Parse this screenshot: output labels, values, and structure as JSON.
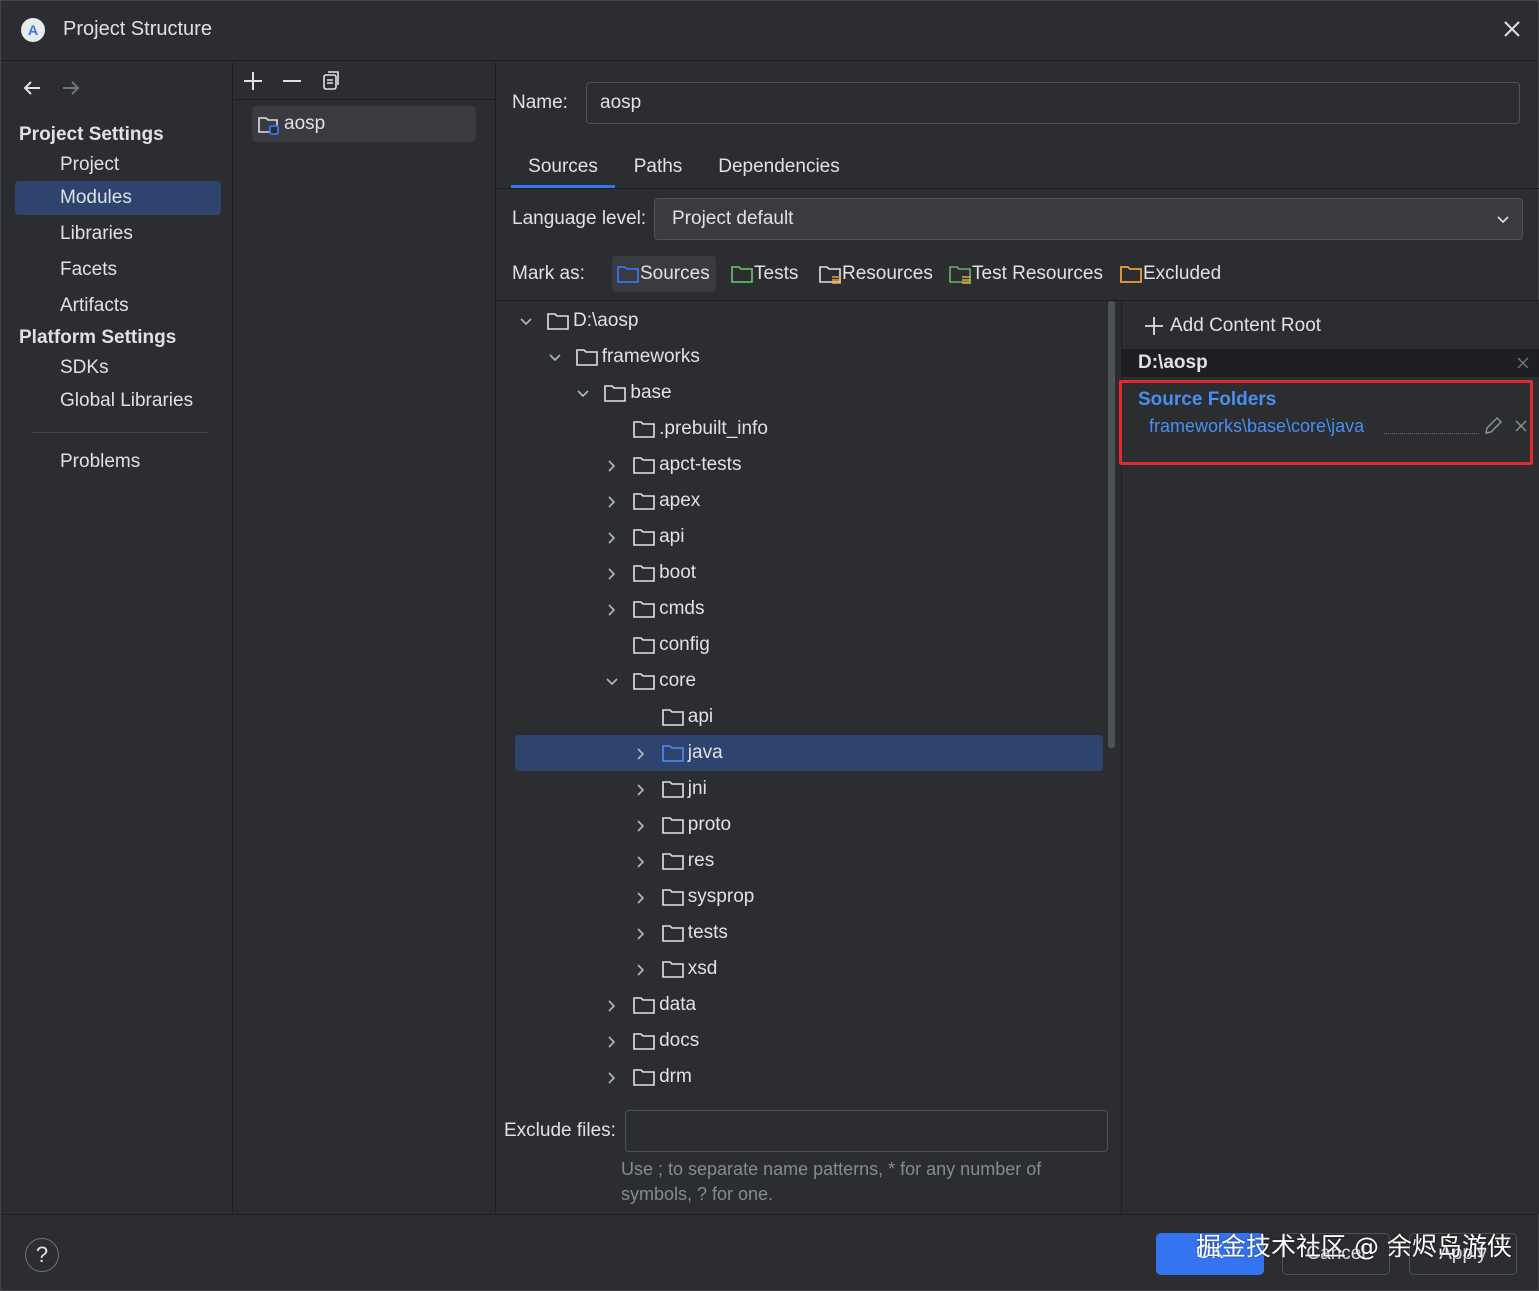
{
  "window": {
    "title": "Project Structure"
  },
  "leftnav": {
    "project_settings_heading": "Project Settings",
    "project_items": [
      "Project",
      "Modules",
      "Libraries",
      "Facets",
      "Artifacts"
    ],
    "selected_item": "Modules",
    "platform_settings_heading": "Platform Settings",
    "platform_items": [
      "SDKs",
      "Global Libraries"
    ],
    "problems": "Problems"
  },
  "modules": {
    "items": [
      "aosp"
    ]
  },
  "main": {
    "name_label": "Name:",
    "name_value": "aosp",
    "tabs": [
      "Sources",
      "Paths",
      "Dependencies"
    ],
    "active_tab": "Sources",
    "language_level_label": "Language level:",
    "language_level_value": "Project default",
    "mark_as_label": "Mark as:",
    "mark_as_buttons": [
      "Sources",
      "Tests",
      "Resources",
      "Test Resources",
      "Excluded"
    ],
    "exclude_files_label": "Exclude files:",
    "exclude_files_value": "",
    "exclude_hint": "Use ; to separate name patterns, * for any number of symbols, ? for one."
  },
  "tree": {
    "rows": [
      {
        "label": "D:\\aosp",
        "expanded": true
      },
      {
        "label": "frameworks",
        "expanded": true
      },
      {
        "label": "base",
        "expanded": true
      },
      {
        "label": ".prebuilt_info"
      },
      {
        "label": "apct-tests"
      },
      {
        "label": "apex"
      },
      {
        "label": "api"
      },
      {
        "label": "boot"
      },
      {
        "label": "cmds"
      },
      {
        "label": "config"
      },
      {
        "label": "core",
        "expanded": true
      },
      {
        "label": "api"
      },
      {
        "label": "java",
        "selected": true
      },
      {
        "label": "jni"
      },
      {
        "label": "proto"
      },
      {
        "label": "res"
      },
      {
        "label": "sysprop"
      },
      {
        "label": "tests"
      },
      {
        "label": "xsd"
      },
      {
        "label": "data"
      },
      {
        "label": "docs"
      },
      {
        "label": "drm"
      }
    ]
  },
  "content_root": {
    "add_label": "Add Content Root",
    "root_path": "D:\\aosp",
    "source_folders_title": "Source Folders",
    "source_folder_path": "frameworks\\base\\core\\java"
  },
  "footer": {
    "help": "?",
    "ok": "OK",
    "cancel": "Cancel",
    "apply": "Apply",
    "watermark": "掘金技术社区 @ 余烬岛游侠"
  },
  "colors": {
    "accent": "#3574f0",
    "selection": "#2e436e",
    "highlight_box": "#e5282e",
    "source_folder_text": "#4a8ef0"
  }
}
